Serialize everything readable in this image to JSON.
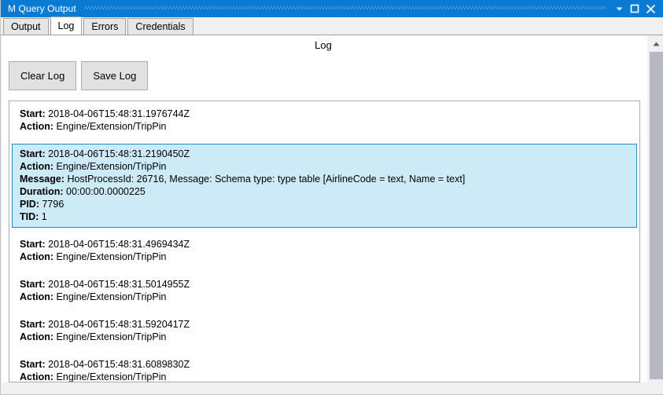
{
  "window": {
    "title": "M Query Output",
    "controls": [
      {
        "name": "minimize-button",
        "icon": "chevron-down-icon",
        "glyph": "▼"
      },
      {
        "name": "maximize-button",
        "icon": "square-icon",
        "glyph": "□"
      },
      {
        "name": "close-button",
        "icon": "close-icon",
        "glyph": "✕"
      }
    ]
  },
  "tabs": [
    {
      "label": "Output",
      "active": false
    },
    {
      "label": "Log",
      "active": true
    },
    {
      "label": "Errors",
      "active": false
    },
    {
      "label": "Credentials",
      "active": false
    }
  ],
  "main": {
    "heading": "Log",
    "buttons": [
      {
        "label": "Clear Log",
        "name": "clear-log-button"
      },
      {
        "label": "Save Log",
        "name": "save-log-button"
      }
    ]
  },
  "log_entries": [
    {
      "selected": false,
      "fields": [
        {
          "label": "Start:",
          "value": "2018-04-06T15:48:31.1976744Z"
        },
        {
          "label": "Action:",
          "value": "Engine/Extension/TripPin"
        }
      ]
    },
    {
      "selected": true,
      "fields": [
        {
          "label": "Start:",
          "value": "2018-04-06T15:48:31.2190450Z"
        },
        {
          "label": "Action:",
          "value": "Engine/Extension/TripPin"
        },
        {
          "label": "Message:",
          "value": "HostProcessId: 26716, Message: Schema type: type table [AirlineCode = text, Name = text]"
        },
        {
          "label": "Duration:",
          "value": "00:00:00.0000225"
        },
        {
          "label": "PID:",
          "value": "7796"
        },
        {
          "label": "TID:",
          "value": "1"
        }
      ]
    },
    {
      "selected": false,
      "fields": [
        {
          "label": "Start:",
          "value": "2018-04-06T15:48:31.4969434Z"
        },
        {
          "label": "Action:",
          "value": "Engine/Extension/TripPin"
        }
      ]
    },
    {
      "selected": false,
      "fields": [
        {
          "label": "Start:",
          "value": "2018-04-06T15:48:31.5014955Z"
        },
        {
          "label": "Action:",
          "value": "Engine/Extension/TripPin"
        }
      ]
    },
    {
      "selected": false,
      "fields": [
        {
          "label": "Start:",
          "value": "2018-04-06T15:48:31.5920417Z"
        },
        {
          "label": "Action:",
          "value": "Engine/Extension/TripPin"
        }
      ]
    },
    {
      "selected": false,
      "fields": [
        {
          "label": "Start:",
          "value": "2018-04-06T15:48:31.6089830Z"
        },
        {
          "label": "Action:",
          "value": "Engine/Extension/TripPin"
        }
      ]
    }
  ],
  "scrollbar": {
    "up_icon": "arrow-up-icon",
    "down_icon": "arrow-down-icon"
  },
  "colors": {
    "titlebar": "#0a7bd4",
    "selection_fill": "#cdeaf7",
    "selection_border": "#1e8fc6",
    "button_face": "#e1e1e1"
  }
}
